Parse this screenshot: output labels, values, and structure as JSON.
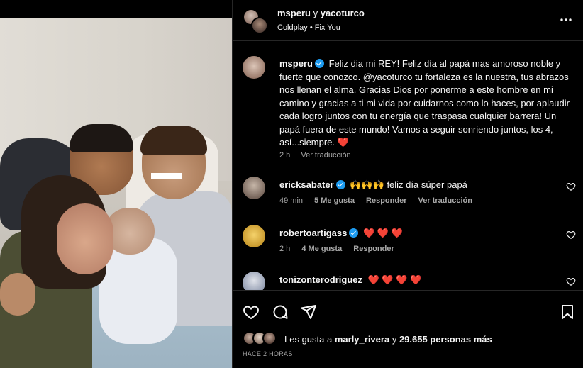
{
  "post": {
    "header": {
      "user1": "msperu",
      "separator": "y",
      "user2": "yacoturco",
      "audio": "Coldplay • Fix You"
    },
    "caption": {
      "username": "msperu",
      "text": "Feliz dia mi REY! Feliz día al papá mas amoroso noble y fuerte que conozco. @yacoturco tu fortaleza es la nuestra, tus abrazos nos llenan el alma. Gracias Dios por ponerme a este hombre en mi camino y gracias a ti mi vida por cuidarnos como lo haces, por aplaudir cada logro juntos con tu energía que traspasa cualquier barrera! Un papá fuera de este mundo! Vamos a seguir sonriendo juntos, los 4, así...siempre.",
      "emoji": "❤️",
      "time": "2 h",
      "translate": "Ver traducción"
    },
    "comments": [
      {
        "username": "ericksabater",
        "verified": true,
        "emoji": "🙌🙌🙌",
        "text": "feliz día súper papá",
        "time": "49 min",
        "likes": "5 Me gusta",
        "reply": "Responder",
        "translate": "Ver traducción"
      },
      {
        "username": "robertoartigass",
        "verified": true,
        "emoji": "❤️ ❤️ ❤️",
        "text": "",
        "time": "2 h",
        "likes": "4 Me gusta",
        "reply": "Responder",
        "translate": ""
      },
      {
        "username": "tonizonterodriguez",
        "verified": false,
        "emoji": "❤️ ❤️ ❤️ ❤️",
        "text": "",
        "time": "",
        "likes": "",
        "reply": "",
        "translate": ""
      }
    ],
    "likes": {
      "prefix": "Les gusta a",
      "user": "marly_rivera",
      "connector": "y",
      "count": "29.655 personas más"
    },
    "time_ago": "HACE 2 HORAS",
    "icons": {
      "like": "heart-icon",
      "comment": "comment-icon",
      "share": "share-icon",
      "save": "bookmark-icon",
      "more": "more-icon"
    },
    "colors": {
      "background": "#000000",
      "text": "#f5f5f5",
      "secondary": "#a8a8a8",
      "verified": "#1d9bf0",
      "heart": "#ff3040"
    }
  }
}
